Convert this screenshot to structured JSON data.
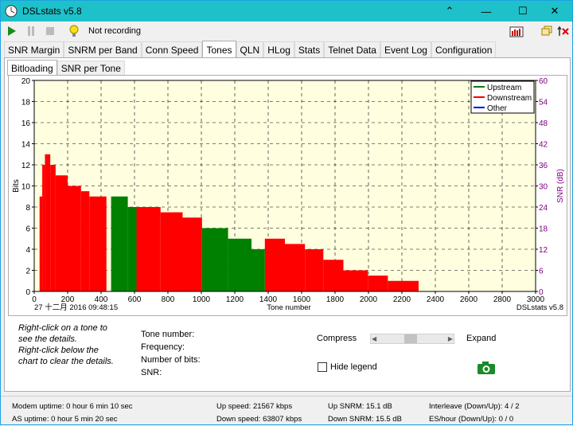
{
  "window": {
    "title": "DSLstats v5.8"
  },
  "toolbar": {
    "status": "Not recording"
  },
  "tabs": [
    "SNR Margin",
    "SNRM per Band",
    "Conn Speed",
    "Tones",
    "QLN",
    "HLog",
    "Stats",
    "Telnet Data",
    "Event Log",
    "Configuration"
  ],
  "active_tab": "Tones",
  "subtabs": [
    "Bitloading",
    "SNR per Tone"
  ],
  "chart_footer": {
    "timestamp": "27 十二月 2016 09:48:15",
    "xlabel": "Tone number",
    "brand": "DSLstats v5.8"
  },
  "chart_data": {
    "type": "bar",
    "xlabel": "Tone number",
    "ylabel": "Bits",
    "y2label": "SNR (dB)",
    "xlim": [
      0,
      3000
    ],
    "ylim": [
      0,
      20
    ],
    "y2lim": [
      0,
      60
    ],
    "xticks": [
      0,
      200,
      400,
      600,
      800,
      1000,
      1200,
      1400,
      1600,
      1800,
      2000,
      2200,
      2400,
      2600,
      2800,
      3000
    ],
    "yticks": [
      0,
      2,
      4,
      6,
      8,
      10,
      12,
      14,
      16,
      18,
      20
    ],
    "y2ticks": [
      0,
      6,
      12,
      18,
      24,
      30,
      36,
      42,
      48,
      54,
      60
    ],
    "grid": true,
    "legend_position": "top-right",
    "legend": [
      {
        "name": "Upstream",
        "color": "#008000"
      },
      {
        "name": "Downstream",
        "color": "#ff0000"
      },
      {
        "name": "Other",
        "color": "#0000ff"
      }
    ],
    "series": [
      {
        "name": "Downstream",
        "color": "#ff0000",
        "segments": [
          [
            32,
            48,
            9
          ],
          [
            48,
            64,
            12
          ],
          [
            64,
            96,
            13
          ],
          [
            96,
            128,
            12
          ],
          [
            128,
            200,
            11
          ],
          [
            200,
            280,
            10
          ],
          [
            280,
            330,
            9.5
          ],
          [
            330,
            432,
            9
          ],
          [
            612,
            756,
            8
          ],
          [
            756,
            888,
            7.5
          ],
          [
            888,
            1004,
            7
          ],
          [
            1380,
            1500,
            5
          ],
          [
            1500,
            1620,
            4.5
          ],
          [
            1620,
            1730,
            4
          ],
          [
            1730,
            1850,
            3
          ],
          [
            1850,
            1996,
            2
          ],
          [
            1996,
            2116,
            1.5
          ],
          [
            2116,
            2300,
            1
          ]
        ]
      },
      {
        "name": "Upstream",
        "color": "#008000",
        "segments": [
          [
            460,
            560,
            9
          ],
          [
            560,
            612,
            8
          ],
          [
            1004,
            1160,
            6
          ],
          [
            1160,
            1300,
            5
          ],
          [
            1300,
            1380,
            4
          ]
        ]
      }
    ]
  },
  "details_hint": [
    "Right-click on a tone to",
    "see the details.",
    "Right-click below the",
    "chart to clear the details."
  ],
  "tone_info": {
    "tone_number": "Tone number:",
    "frequency": "Frequency:",
    "bits": "Number of bits:",
    "snr": "SNR:"
  },
  "controls": {
    "compress": "Compress",
    "expand": "Expand",
    "hide_legend": "Hide legend"
  },
  "status": {
    "modem_uptime": "Modem uptime:  0 hour 6 min 10 sec",
    "as_uptime": "AS uptime:  0 hour 5 min 20 sec",
    "up_speed": "Up speed: 21567 kbps",
    "down_speed": "Down speed: 63807 kbps",
    "up_snrm": "Up SNRM: 15.1 dB",
    "down_snrm": "Down SNRM: 15.5 dB",
    "interleave": "Interleave (Down/Up): 4 / 2",
    "es_hour": "ES/hour (Down/Up): 0 / 0"
  },
  "colors": {
    "titlebar": "#1ec1c9",
    "plot_bg": "#ffffe0",
    "downstream": "#ff0000",
    "upstream": "#008000",
    "other": "#0000ff"
  },
  "icons": {
    "play": "play-icon",
    "pause": "pause-icon",
    "stop": "stop-icon",
    "hint": "lightbulb-icon",
    "camera": "camera-icon"
  }
}
